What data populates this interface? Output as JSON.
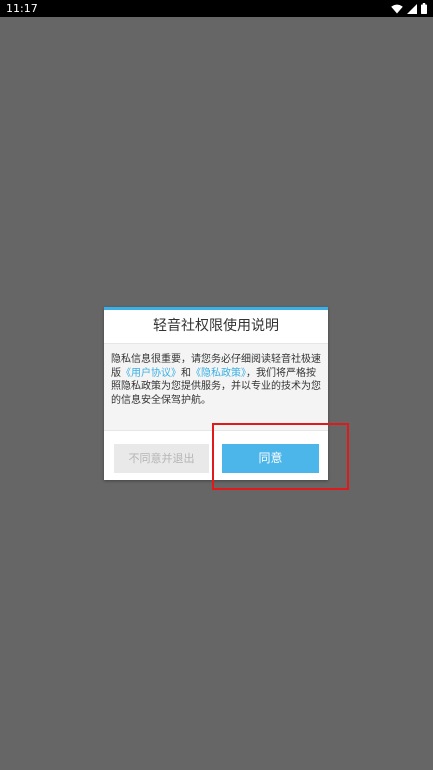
{
  "status_bar": {
    "time": "11:17",
    "icons": [
      "wifi-icon",
      "signal-icon",
      "battery-icon"
    ]
  },
  "dialog": {
    "title": "轻音社权限使用说明",
    "body_part1": "隐私信息很重要，请您务必仔细阅读轻音社极速版",
    "body_link1": "《用户协议》",
    "body_part2": "和",
    "body_link2": "《隐私政策》",
    "body_part3": "，我们将严格按照隐私政策为您提供服务，并以专业的技术为您的信息安全保驾护航。",
    "disagree_label": "不同意并退出",
    "agree_label": "同意"
  },
  "colors": {
    "overlay": "#666666",
    "accent": "#39b0e6",
    "agree_button": "#4cb5ea",
    "highlight": "#e0191b"
  }
}
